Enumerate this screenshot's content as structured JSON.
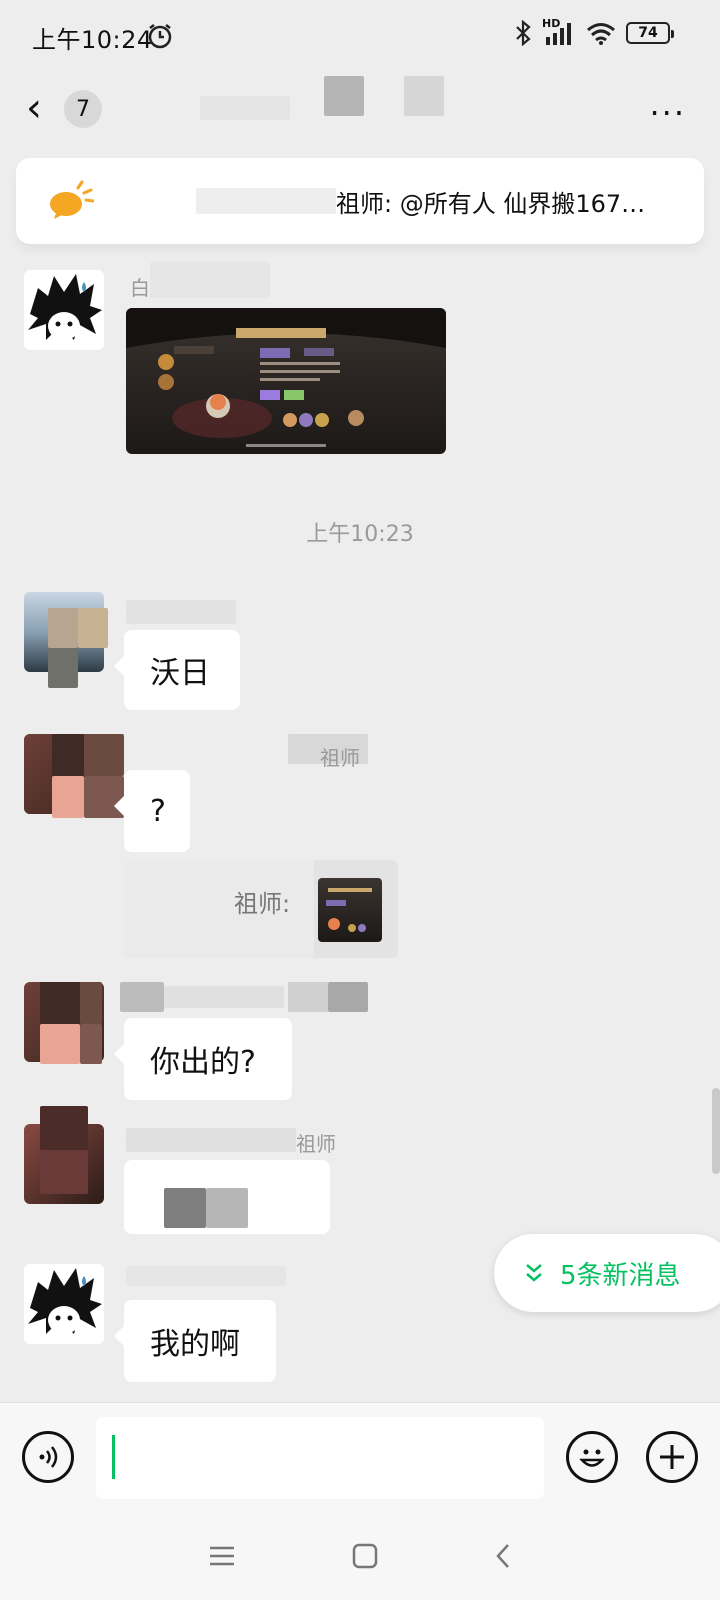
{
  "status": {
    "time": "上午10:24",
    "hd": "HD",
    "battery": "74"
  },
  "header": {
    "back_icon": "‹",
    "unread_count": "7",
    "more": "···"
  },
  "notice": {
    "text": "祖师: @所有人 仙界搬167…"
  },
  "messages": {
    "timestamp": "上午10:23",
    "m1_name": "白",
    "m2_text": "沃日",
    "m3_name": "祖师",
    "m3_text": "?",
    "m3_quote": "祖师:",
    "m4_text": "你出的?",
    "m5_name": "祖师",
    "m6_text": "我的啊"
  },
  "new_messages": {
    "label": "5条新消息",
    "icon": "double-chevron-down"
  },
  "colors": {
    "accent": "#07c160",
    "background": "#ededed",
    "bubble": "#ffffff"
  }
}
